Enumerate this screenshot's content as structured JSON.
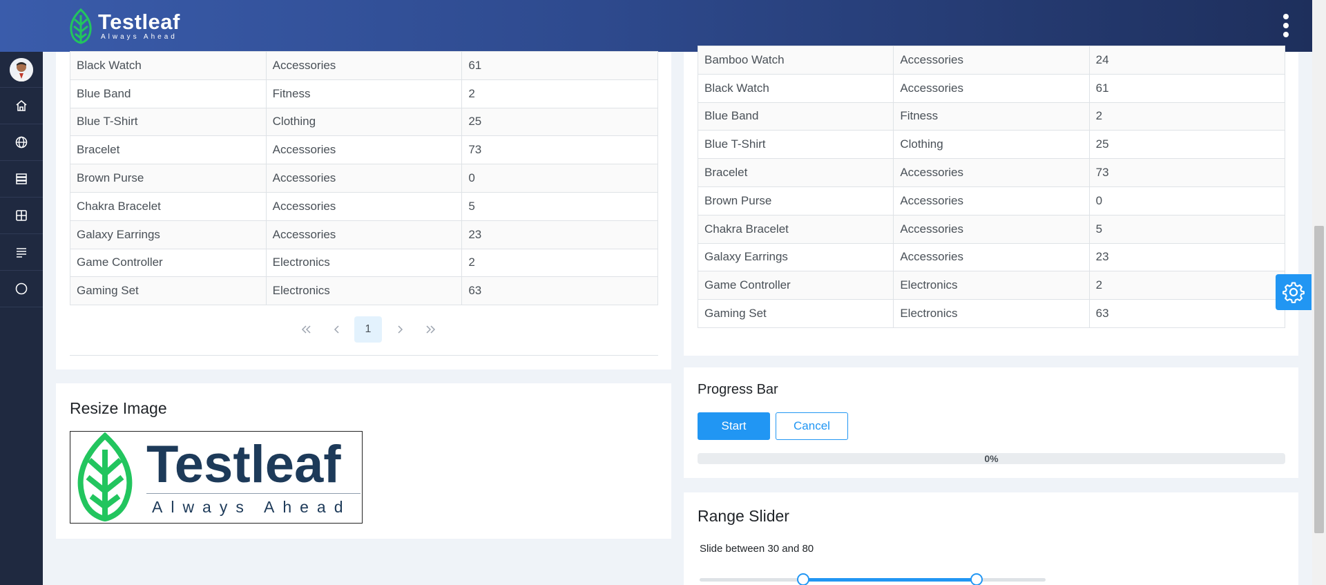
{
  "header": {
    "logo_title": "Testleaf",
    "logo_tagline": "Always Ahead"
  },
  "sidebar": {
    "items": [
      {
        "name": "home-icon"
      },
      {
        "name": "globe-icon"
      },
      {
        "name": "server-icon"
      },
      {
        "name": "table-icon"
      },
      {
        "name": "align-left-icon"
      },
      {
        "name": "circle-icon"
      }
    ]
  },
  "left_table": {
    "rows": [
      [
        "Black Watch",
        "Accessories",
        "61"
      ],
      [
        "Blue Band",
        "Fitness",
        "2"
      ],
      [
        "Blue T-Shirt",
        "Clothing",
        "25"
      ],
      [
        "Bracelet",
        "Accessories",
        "73"
      ],
      [
        "Brown Purse",
        "Accessories",
        "0"
      ],
      [
        "Chakra Bracelet",
        "Accessories",
        "5"
      ],
      [
        "Galaxy Earrings",
        "Accessories",
        "23"
      ],
      [
        "Game Controller",
        "Electronics",
        "2"
      ],
      [
        "Gaming Set",
        "Electronics",
        "63"
      ]
    ],
    "paginator": {
      "first": "«",
      "prev": "‹",
      "page": "1",
      "next": "›",
      "last": "»"
    }
  },
  "right_table": {
    "rows": [
      [
        "Bamboo Watch",
        "Accessories",
        "24"
      ],
      [
        "Black Watch",
        "Accessories",
        "61"
      ],
      [
        "Blue Band",
        "Fitness",
        "2"
      ],
      [
        "Blue T-Shirt",
        "Clothing",
        "25"
      ],
      [
        "Bracelet",
        "Accessories",
        "73"
      ],
      [
        "Brown Purse",
        "Accessories",
        "0"
      ],
      [
        "Chakra Bracelet",
        "Accessories",
        "5"
      ],
      [
        "Galaxy Earrings",
        "Accessories",
        "23"
      ],
      [
        "Game Controller",
        "Electronics",
        "2"
      ],
      [
        "Gaming Set",
        "Electronics",
        "63"
      ]
    ]
  },
  "resize_image": {
    "title": "Resize Image",
    "image_title": "Testleaf",
    "image_tagline": "Always Ahead"
  },
  "progress_bar": {
    "title": "Progress Bar",
    "start_label": "Start",
    "cancel_label": "Cancel",
    "value_label": "0%",
    "value": 0
  },
  "range_slider": {
    "title": "Range Slider",
    "caption": "Slide between 30 and 80",
    "min": 0,
    "max": 100,
    "low": 30,
    "high": 80
  },
  "colors": {
    "accent": "#2196f3",
    "sidebar": "#1f2940",
    "logo_green": "#22c55e",
    "logo_navy": "#1d3a59"
  }
}
